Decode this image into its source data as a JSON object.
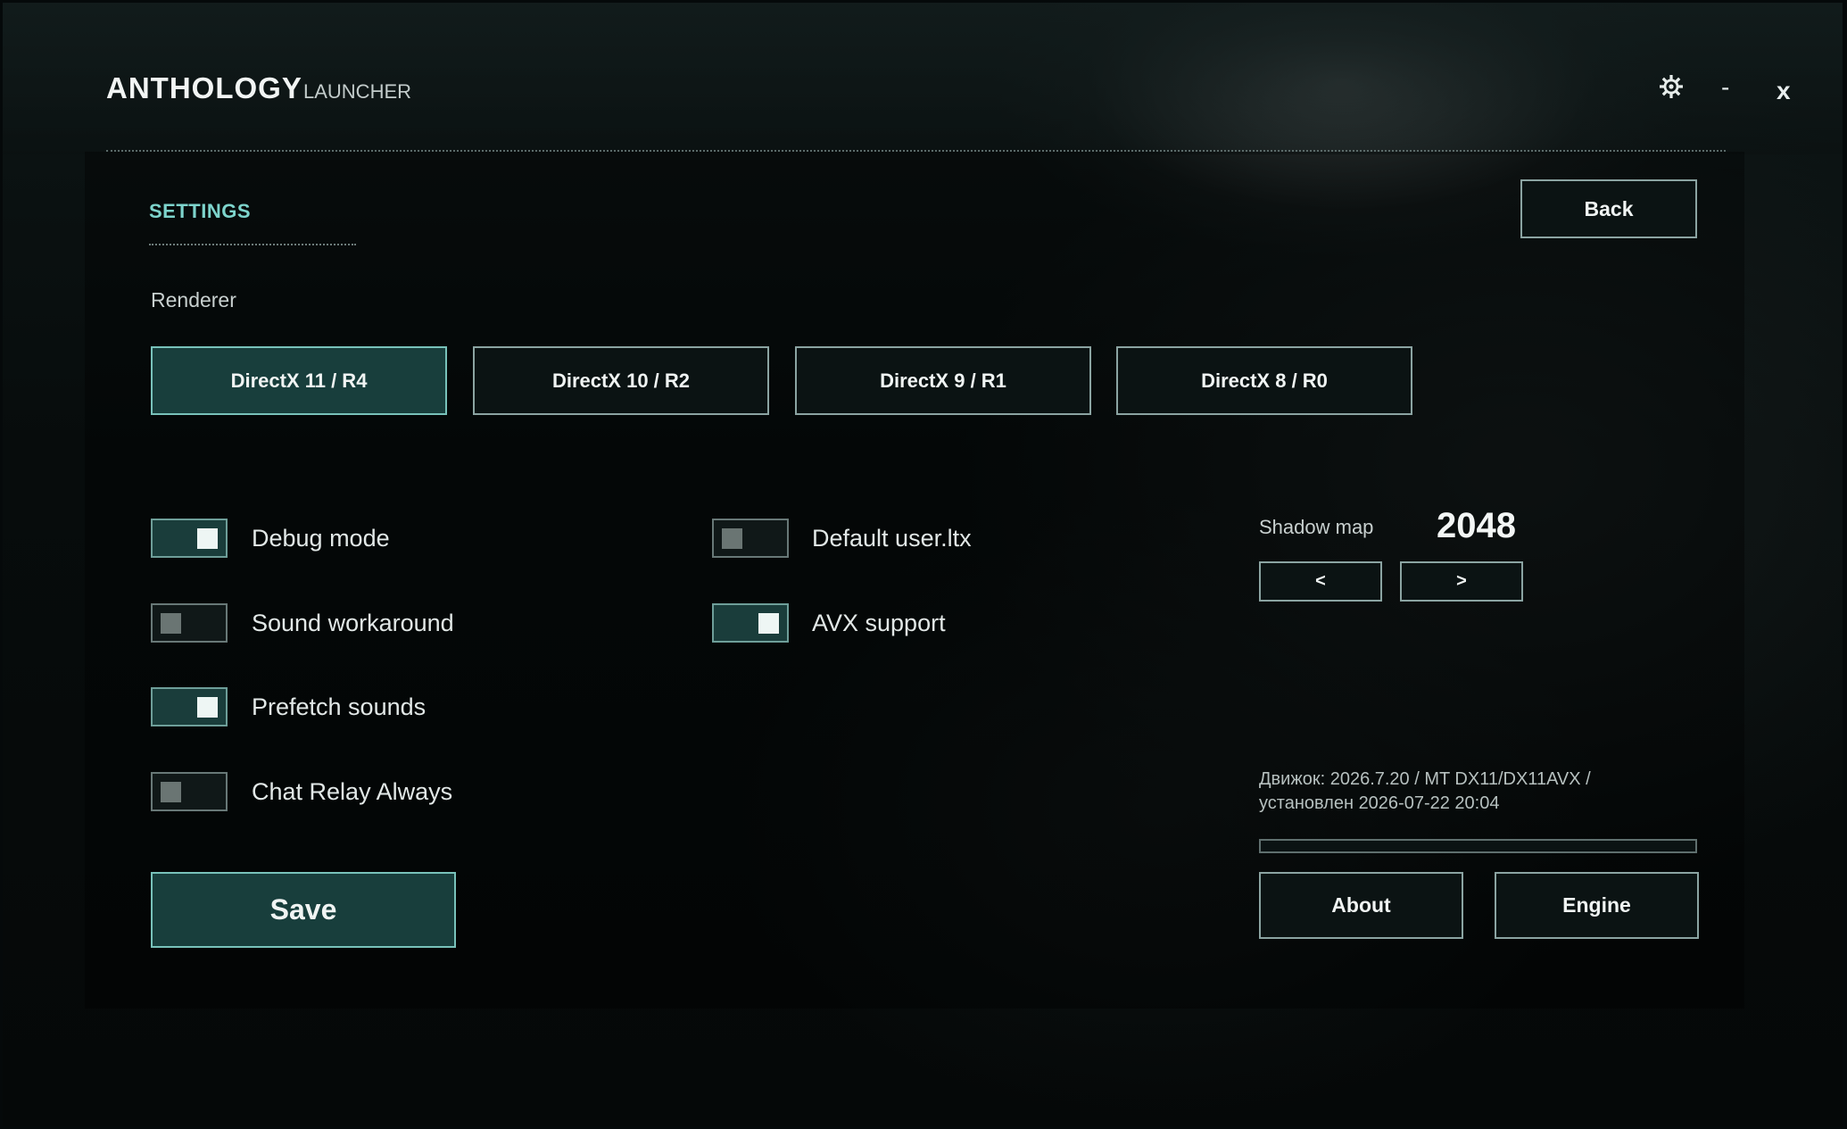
{
  "app": {
    "title": "ANTHOLOGY",
    "subtitle": "LAUNCHER",
    "settings_icon": "gear-icon",
    "minimize_label": "-",
    "close_label": "x"
  },
  "settings": {
    "tab_label": "SETTINGS",
    "back_label": "Back",
    "renderer": {
      "label": "Renderer",
      "options": [
        {
          "label": "DirectX 11 / R4",
          "selected": true
        },
        {
          "label": "DirectX 10 / R2",
          "selected": false
        },
        {
          "label": "DirectX 9 / R1",
          "selected": false
        },
        {
          "label": "DirectX 8 / R0",
          "selected": false
        }
      ]
    },
    "toggles": {
      "debug_mode": {
        "label": "Debug mode",
        "on": true
      },
      "sound_workaround": {
        "label": "Sound workaround",
        "on": false
      },
      "prefetch_sounds": {
        "label": "Prefetch sounds",
        "on": true
      },
      "chat_relay_always": {
        "label": "Chat Relay Always",
        "on": false
      },
      "default_user_ltx": {
        "label": "Default user.ltx",
        "on": false
      },
      "avx_support": {
        "label": "AVX support",
        "on": true
      }
    },
    "shadow_map": {
      "label": "Shadow map",
      "value": "2048",
      "prev_label": "<",
      "next_label": ">"
    },
    "engine_info": {
      "line1": "Движок: 2026.7.20 / MT DX11/DX11AVX /",
      "line2": "установлен 2026-07-22 20:04"
    },
    "progress": 0,
    "save_label": "Save",
    "about_label": "About",
    "engine_label": "Engine"
  },
  "colors": {
    "accent": "#7dd4cc",
    "active_button": "#183e3c",
    "border": "#8ba4a2"
  }
}
